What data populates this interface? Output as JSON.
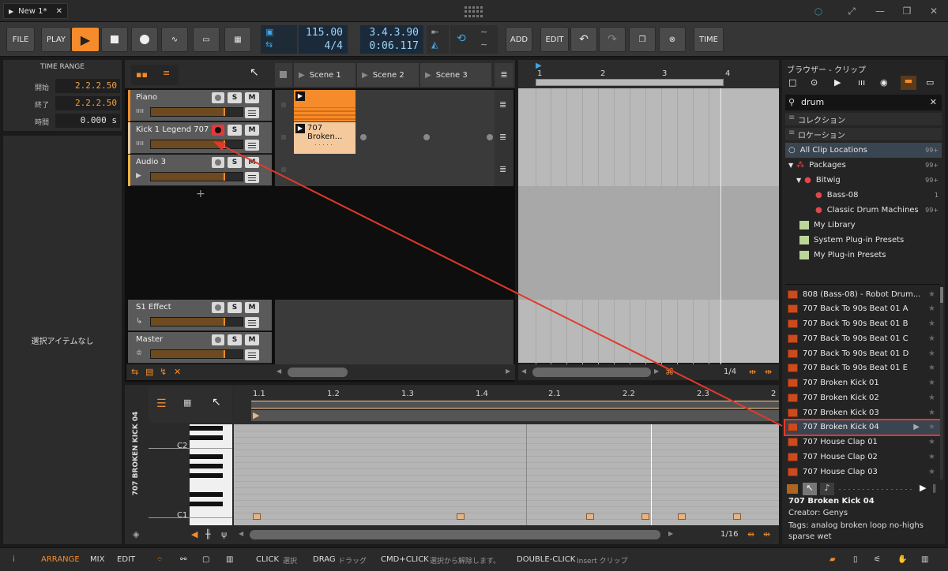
{
  "window": {
    "tab_title": "New 1*"
  },
  "toolbar": {
    "file": "FILE",
    "play_label": "PLAY",
    "tempo": "115.00",
    "time_sig": "4/4",
    "position_bars": "3.4.3.90",
    "position_time": "0:06.117",
    "add": "ADD",
    "edit": "EDIT",
    "time": "TIME"
  },
  "time_range": {
    "title": "TIME RANGE",
    "rows": [
      {
        "label": "開始",
        "value": "2.2.2.50"
      },
      {
        "label": "終了",
        "value": "2.2.2.50"
      },
      {
        "label": "時間",
        "value": "0.000 s"
      }
    ]
  },
  "inspector": {
    "empty": "選択アイテムなし"
  },
  "scenes": [
    "Scene 1",
    "Scene 2",
    "Scene 3"
  ],
  "tracks": [
    {
      "name": "Piano",
      "color": "#f58b2a"
    },
    {
      "name": "Kick 1 Legend 707",
      "color": "#e8c89a"
    },
    {
      "name": "Audio 3",
      "color": "#f0b43c"
    },
    {
      "name": "S1 Effect",
      "color": "#5a5a5a"
    },
    {
      "name": "Master",
      "color": "#5a5a5a"
    }
  ],
  "clips": {
    "kick_clip": "707 Broken..."
  },
  "arranger": {
    "bars": [
      "1",
      "2",
      "3",
      "4"
    ],
    "zoom": "1/4"
  },
  "piano_roll": {
    "track_label": "707 BROKEN KICK 04",
    "ruler": [
      "1.1",
      "1.2",
      "1.3",
      "1.4",
      "2.1",
      "2.2",
      "2.3",
      "2"
    ],
    "keys": [
      "C2",
      "C1"
    ],
    "zoom": "1/16"
  },
  "browser": {
    "title": "ブラウザー - クリップ",
    "search_value": "drum",
    "sections": [
      "コレクション",
      "ロケーション"
    ],
    "locations": [
      {
        "label": "All Clip Locations",
        "count": "99+"
      },
      {
        "label": "Packages",
        "count": "99+"
      },
      {
        "label": "Bitwig",
        "count": "99+"
      },
      {
        "label": "Bass-08",
        "count": "1"
      },
      {
        "label": "Classic Drum Machines",
        "count": "99+"
      },
      {
        "label": "My Library",
        "count": ""
      },
      {
        "label": "System Plug-in Presets",
        "count": ""
      },
      {
        "label": "My Plug-in Presets",
        "count": ""
      }
    ],
    "results": [
      "808 (Bass-08) - Robot Drum...",
      "707 Back To 90s Beat 01 A",
      "707 Back To 90s Beat 01 B",
      "707 Back To 90s Beat 01 C",
      "707 Back To 90s Beat 01 D",
      "707 Back To 90s Beat 01 E",
      "707 Broken Kick 01",
      "707 Broken Kick 02",
      "707 Broken Kick 03",
      "707 Broken Kick 04",
      "707 House Clap 01",
      "707 House Clap 02",
      "707 House Clap 03"
    ],
    "selected_index": 9,
    "preview": {
      "name": "707 Broken Kick 04",
      "creator": "Creator: Genys",
      "tags": "Tags: analog broken loop no-highs sparse wet"
    }
  },
  "bottom_bar": {
    "arrange": "ARRANGE",
    "mix": "MIX",
    "edit": "EDIT",
    "hints": [
      {
        "key": "CLICK",
        "desc": "選択"
      },
      {
        "key": "DRAG",
        "desc": "ドラッグ"
      },
      {
        "key": "CMD+CLICK",
        "desc": "選択から解除します。"
      },
      {
        "key": "DOUBLE-CLICK",
        "desc": "Insert クリップ"
      }
    ]
  }
}
